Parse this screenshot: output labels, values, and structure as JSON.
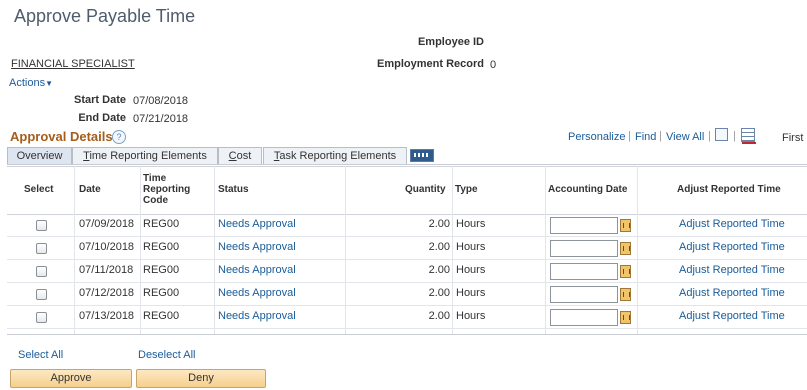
{
  "page_title": "Approve Payable Time",
  "employee": {
    "id_label": "Employee ID",
    "id_value": "",
    "record_label": "Employment Record",
    "record_value": "0",
    "job_title": "FINANCIAL SPECIALIST"
  },
  "actions_label": "Actions",
  "dates": {
    "start_label": "Start Date",
    "start_value": "07/08/2018",
    "end_label": "End Date",
    "end_value": "07/21/2018"
  },
  "section": {
    "title": "Approval Details",
    "help": "?"
  },
  "grid_nav": {
    "personalize": "Personalize",
    "find": "Find",
    "view_all": "View All",
    "first": "First",
    "sep": "|"
  },
  "tabs": [
    {
      "label": "Overview",
      "active": true
    },
    {
      "label": "Time Reporting Elements",
      "active": false
    },
    {
      "label": "Cost",
      "active": false
    },
    {
      "label": "Task Reporting Elements",
      "active": false
    }
  ],
  "columns": {
    "select": "Select",
    "date": "Date",
    "trc_1": "Time",
    "trc_2": "Reporting",
    "trc_3": "Code",
    "status": "Status",
    "quantity": "Quantity",
    "type": "Type",
    "accounting_date": "Accounting Date",
    "adjust": "Adjust Reported Time"
  },
  "rows": [
    {
      "date": "07/09/2018",
      "trc": "REG00",
      "status": "Needs Approval",
      "quantity": "2.00",
      "type": "Hours",
      "accounting_date": "",
      "adjust": "Adjust Reported Time"
    },
    {
      "date": "07/10/2018",
      "trc": "REG00",
      "status": "Needs Approval",
      "quantity": "2.00",
      "type": "Hours",
      "accounting_date": "",
      "adjust": "Adjust Reported Time"
    },
    {
      "date": "07/11/2018",
      "trc": "REG00",
      "status": "Needs Approval",
      "quantity": "2.00",
      "type": "Hours",
      "accounting_date": "",
      "adjust": "Adjust Reported Time"
    },
    {
      "date": "07/12/2018",
      "trc": "REG00",
      "status": "Needs Approval",
      "quantity": "2.00",
      "type": "Hours",
      "accounting_date": "",
      "adjust": "Adjust Reported Time"
    },
    {
      "date": "07/13/2018",
      "trc": "REG00",
      "status": "Needs Approval",
      "quantity": "2.00",
      "type": "Hours",
      "accounting_date": "",
      "adjust": "Adjust Reported Time"
    }
  ],
  "footer": {
    "select_all": "Select All",
    "deselect_all": "Deselect All",
    "approve": "Approve",
    "deny": "Deny"
  },
  "colors": {
    "link": "#1a5c99",
    "section_title": "#a65c1a",
    "button_bg": "#f6cf8c"
  }
}
